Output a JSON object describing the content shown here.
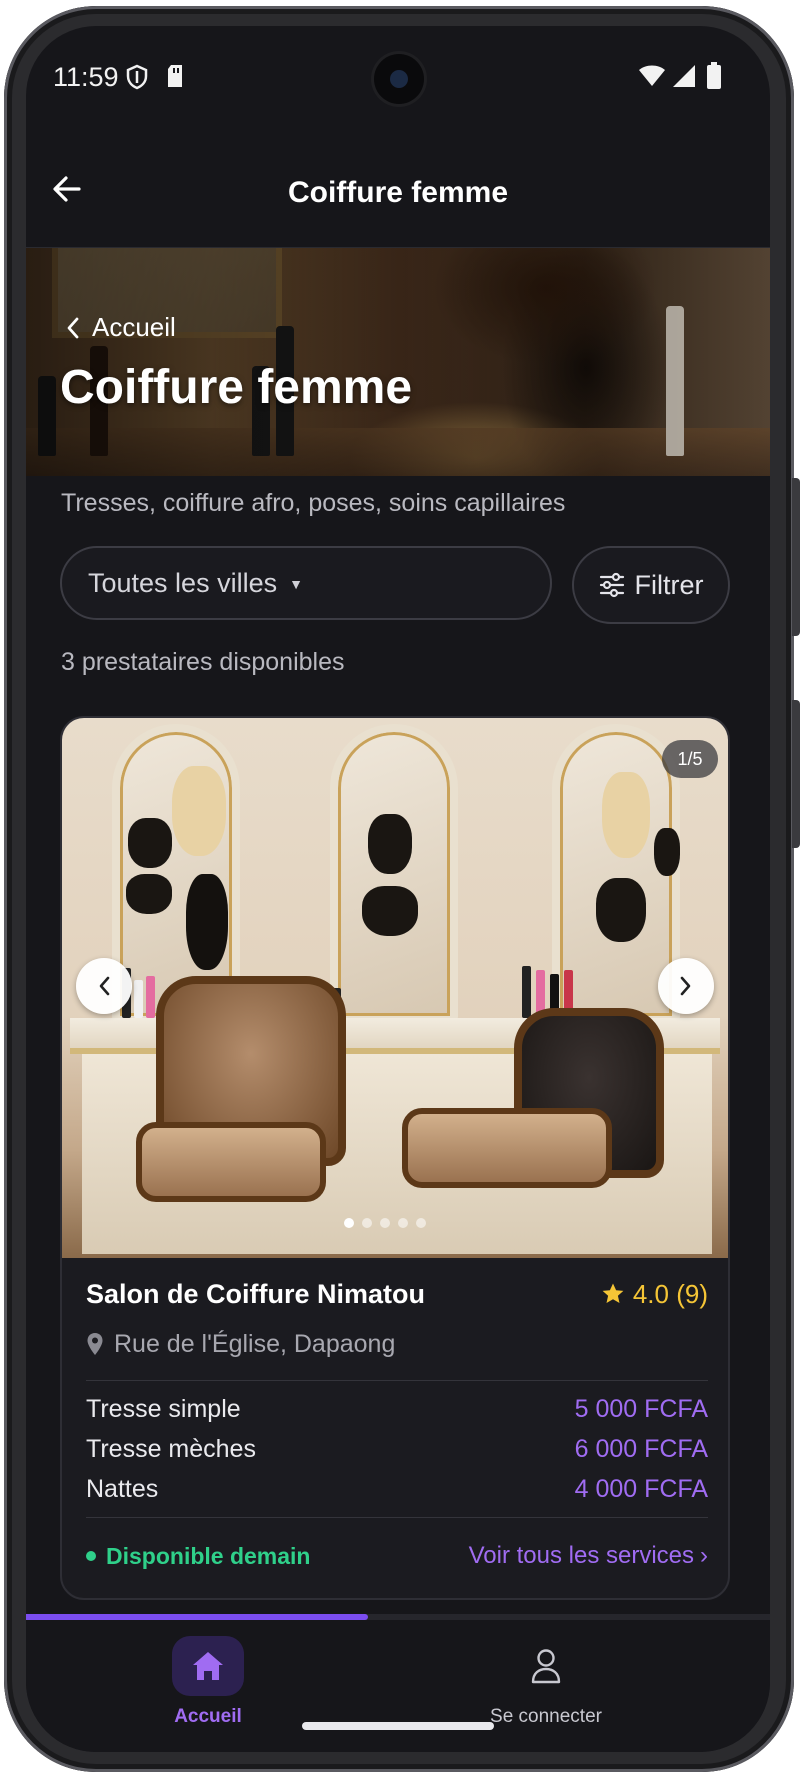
{
  "status_bar": {
    "time": "11:59"
  },
  "app_bar": {
    "title": "Coiffure femme"
  },
  "hero": {
    "breadcrumb": "Accueil",
    "title": "Coiffure femme"
  },
  "category": {
    "description": "Tresses, coiffure afro, poses, soins capillaires"
  },
  "filters": {
    "city_select": "Toutes les villes",
    "filter_label": "Filtrer"
  },
  "results": {
    "count_text": "3 prestataires disponibles"
  },
  "providers": [
    {
      "photo_counter": "1/5",
      "photo_count": 5,
      "active_photo_index": 0,
      "name": "Salon de Coiffure Nimatou",
      "rating": "4.0 (9)",
      "address": "Rue de l'Église, Dapaong",
      "services": [
        {
          "name": "Tresse simple",
          "price": "5 000 FCFA"
        },
        {
          "name": "Tresse mèches",
          "price": "6 000 FCFA"
        },
        {
          "name": "Nattes",
          "price": "4 000 FCFA"
        }
      ],
      "availability": "Disponible demain",
      "see_all": "Voir tous les services"
    }
  ],
  "scroll_progress": 0.46,
  "bottom_nav": [
    {
      "label": "Accueil",
      "icon": "home-icon",
      "active": true
    },
    {
      "label": "Se connecter",
      "icon": "user-icon",
      "active": false
    }
  ],
  "colors": {
    "accent": "#a06cf2",
    "accent_bar": "#7b4df0",
    "available": "#2fd08a",
    "star": "#f5c536",
    "background": "#16161a"
  }
}
